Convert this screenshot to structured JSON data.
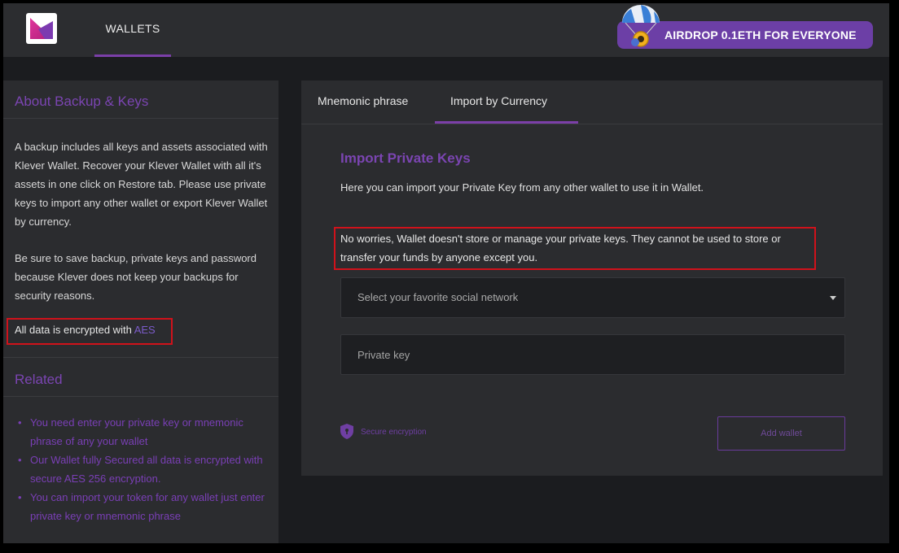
{
  "header": {
    "nav_tab_label": "WALLETS",
    "airdrop_label": "AIRDROP 0.1ETH FOR EVERYONE"
  },
  "sidebar": {
    "about_title": "About Backup & Keys",
    "about_paragraph_1": "A backup includes all keys and assets associated with Klever Wallet. Recover your Klever Wallet with all it's assets in one click on Restore tab. Please use private keys to import any other wallet or export Klever Wallet by currency.",
    "about_paragraph_2": "Be sure to save backup, private keys and password because Klever does not keep your backups for security reasons.",
    "encryption_text": "All data is encrypted with ",
    "encryption_link": "AES",
    "related_title": "Related",
    "related_items": [
      "You need enter your private key or mnemonic phrase of any your wallet",
      "Our Wallet fully Secured all data is encrypted with secure AES 256 encryption.",
      "You can import your token for any wallet just enter private key or mnemonic phrase"
    ]
  },
  "main": {
    "tabs": [
      {
        "label": "Mnemonic phrase",
        "active": false
      },
      {
        "label": "Import by Currency",
        "active": true
      }
    ],
    "import_title": "Import Private Keys",
    "import_description": "Here you can import your Private Key from any other wallet to use it in Wallet.",
    "worries_text": "No worries, Wallet doesn't store or manage your private keys. They cannot be used to store or transfer your funds by anyone except you.",
    "select": {
      "selected_label": "Select your favorite social network"
    },
    "private_key_input": {
      "value": "",
      "placeholder": "Private key"
    },
    "secure_label": "Secure encryption",
    "add_button_label": "Add wallet"
  },
  "colors": {
    "accent_purple": "#7b45b2",
    "highlight_red": "#d0121b",
    "panel_bg": "#2b2c2f",
    "page_bg": "#1b1c1f"
  },
  "icons": {
    "logo": "klever-logo-icon",
    "airdrop": "airdrop-balloon-icon",
    "caret": "chevron-down-icon",
    "secure": "shield-icon"
  }
}
